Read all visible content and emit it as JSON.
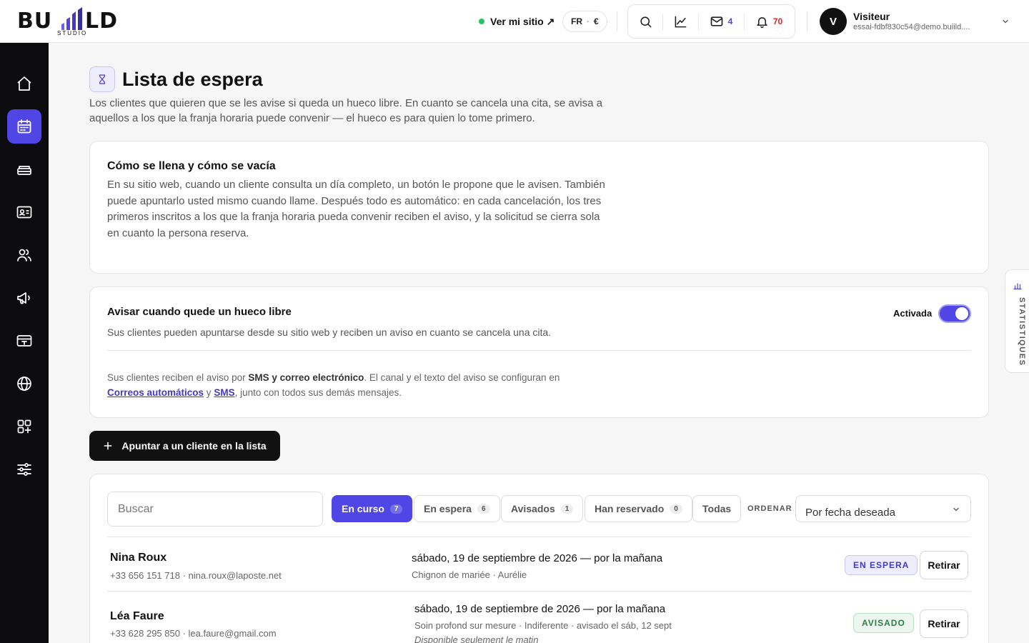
{
  "brand": {
    "logo_main": "BU LD",
    "logo_sub": "STUDIO"
  },
  "topbar": {
    "site_link": "Ver mi sitio ↗",
    "lang": "FR",
    "currency": "€",
    "messages_count": "4",
    "notifications_count": "70",
    "status_color": "#22c55e"
  },
  "user": {
    "initial": "V",
    "name": "Visiteur",
    "email": "essai-fdbf830c54@demo.buiild...."
  },
  "sidebar": {
    "items": [
      {
        "icon": "home-icon",
        "active": false
      },
      {
        "icon": "calendar-icon",
        "active": true
      },
      {
        "icon": "services-icon",
        "active": false
      },
      {
        "icon": "id-card-icon",
        "active": false
      },
      {
        "icon": "users-icon",
        "active": false
      },
      {
        "icon": "megaphone-icon",
        "active": false
      },
      {
        "icon": "payment-card-icon",
        "active": false
      },
      {
        "icon": "globe-icon",
        "active": false
      },
      {
        "icon": "apps-icon",
        "active": false
      },
      {
        "icon": "settings-sliders-icon",
        "active": false
      }
    ]
  },
  "page": {
    "title": "Lista de espera",
    "description": "Los clientes que quieren que se les avise si queda un hueco libre. En cuanto se cancela una cita, se avisa a aquellos a los que la franja horaria puede convenir — el hueco es para quien lo tome primero."
  },
  "how_it_works": {
    "title": "Cómo se llena y cómo se vacía",
    "text": "En su sitio web, cuando un cliente consulta un día completo, un botón le propone que le avisen. También puede apuntarlo usted mismo cuando llame. Después todo es automático: en cada cancelación, los tres primeros inscritos a los que la franja horaria pueda convenir reciben el aviso, y la solicitud se cierra sola en cuanto la persona reserva."
  },
  "notify": {
    "title": "Avisar cuando quede un hueco libre",
    "text": "Sus clientes pueden apuntarse desde su sitio web y reciben un aviso en cuanto se cancela una cita.",
    "toggle_label": "Activada",
    "toggle_on": true,
    "note_1": "Sus clientes reciben el aviso por ",
    "note_channels": "SMS y correo electrónico",
    "note_2": ". El canal y el texto del aviso se configuran en ",
    "link_emails": "Correos automáticos",
    "note_3": " y ",
    "link_sms": "SMS",
    "note_4": ", junto con todos sus demás mensajes."
  },
  "add_button": "Apuntar a un cliente en la lista",
  "list": {
    "search_placeholder": "Buscar",
    "filters": [
      {
        "label": "En curso",
        "count": "7",
        "active": true
      },
      {
        "label": "En espera",
        "count": "6",
        "active": false
      },
      {
        "label": "Avisados",
        "count": "1",
        "active": false
      },
      {
        "label": "Han reservado",
        "count": "0",
        "active": false
      },
      {
        "label": "Todas",
        "count": "",
        "active": false
      }
    ],
    "sort_label": "ORDENAR",
    "sort_value": "Por fecha deseada",
    "rows": [
      {
        "name": "Nina Roux",
        "contact": "+33 656 151 718 · nina.roux@laposte.net",
        "date": "sábado, 19 de septiembre de 2026 — por la mañana",
        "service": "Chignon de mariée · Aurélie",
        "note": "",
        "status": "EN ESPERA",
        "action": "Retirar"
      },
      {
        "name": "Léa Faure",
        "contact": "+33 628 295 850 · lea.faure@gmail.com",
        "date": "sábado, 19 de septiembre de 2026 — por la mañana",
        "service": "Soin profond sur mesure · Indiferente · avisado el sáb, 12 sept",
        "note": "Disponible seulement le matin",
        "status": "AVISADO",
        "action": "Retirar"
      }
    ]
  },
  "stats_tab": "STATISTIQUES"
}
